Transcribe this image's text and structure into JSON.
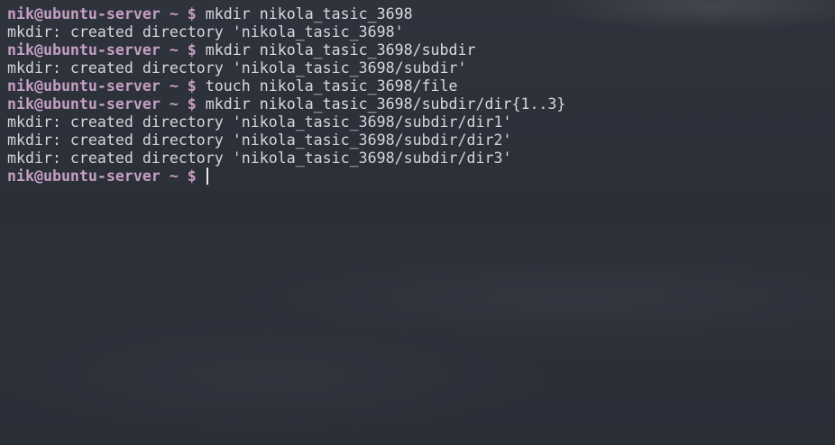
{
  "terminal": {
    "prompt": "nik@ubuntu-server ~ $",
    "lines": [
      {
        "type": "command",
        "text": "mkdir nikola_tasic_3698"
      },
      {
        "type": "output",
        "text": "mkdir: created directory 'nikola_tasic_3698'"
      },
      {
        "type": "command",
        "text": "mkdir nikola_tasic_3698/subdir"
      },
      {
        "type": "output",
        "text": "mkdir: created directory 'nikola_tasic_3698/subdir'"
      },
      {
        "type": "command",
        "text": "touch nikola_tasic_3698/file"
      },
      {
        "type": "command",
        "text": "mkdir nikola_tasic_3698/subdir/dir{1..3}"
      },
      {
        "type": "output",
        "text": "mkdir: created directory 'nikola_tasic_3698/subdir/dir1'"
      },
      {
        "type": "output",
        "text": "mkdir: created directory 'nikola_tasic_3698/subdir/dir2'"
      },
      {
        "type": "output",
        "text": "mkdir: created directory 'nikola_tasic_3698/subdir/dir3'"
      }
    ],
    "current_input": ""
  }
}
